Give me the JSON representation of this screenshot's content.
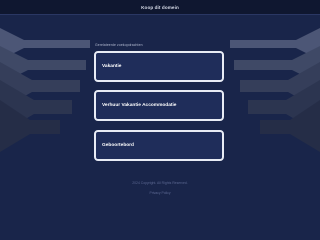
{
  "topbar": {
    "link_label": "Koop dit domein"
  },
  "related": {
    "heading": "Gerelateerde zoekopdrachten",
    "links": [
      {
        "label": "Vakantie"
      },
      {
        "label": "Verhuur Vakantie Accommodatie"
      },
      {
        "label": "Geboortebord"
      }
    ]
  },
  "footer": {
    "copyright": "2024 Copyright. All Rights Reserved.",
    "link": "Privacy Policy"
  },
  "colors": {
    "background": "#19254a",
    "topbar": "#0f1730",
    "box_fill": "#1f2d5a",
    "box_border": "#e8ecf5"
  }
}
